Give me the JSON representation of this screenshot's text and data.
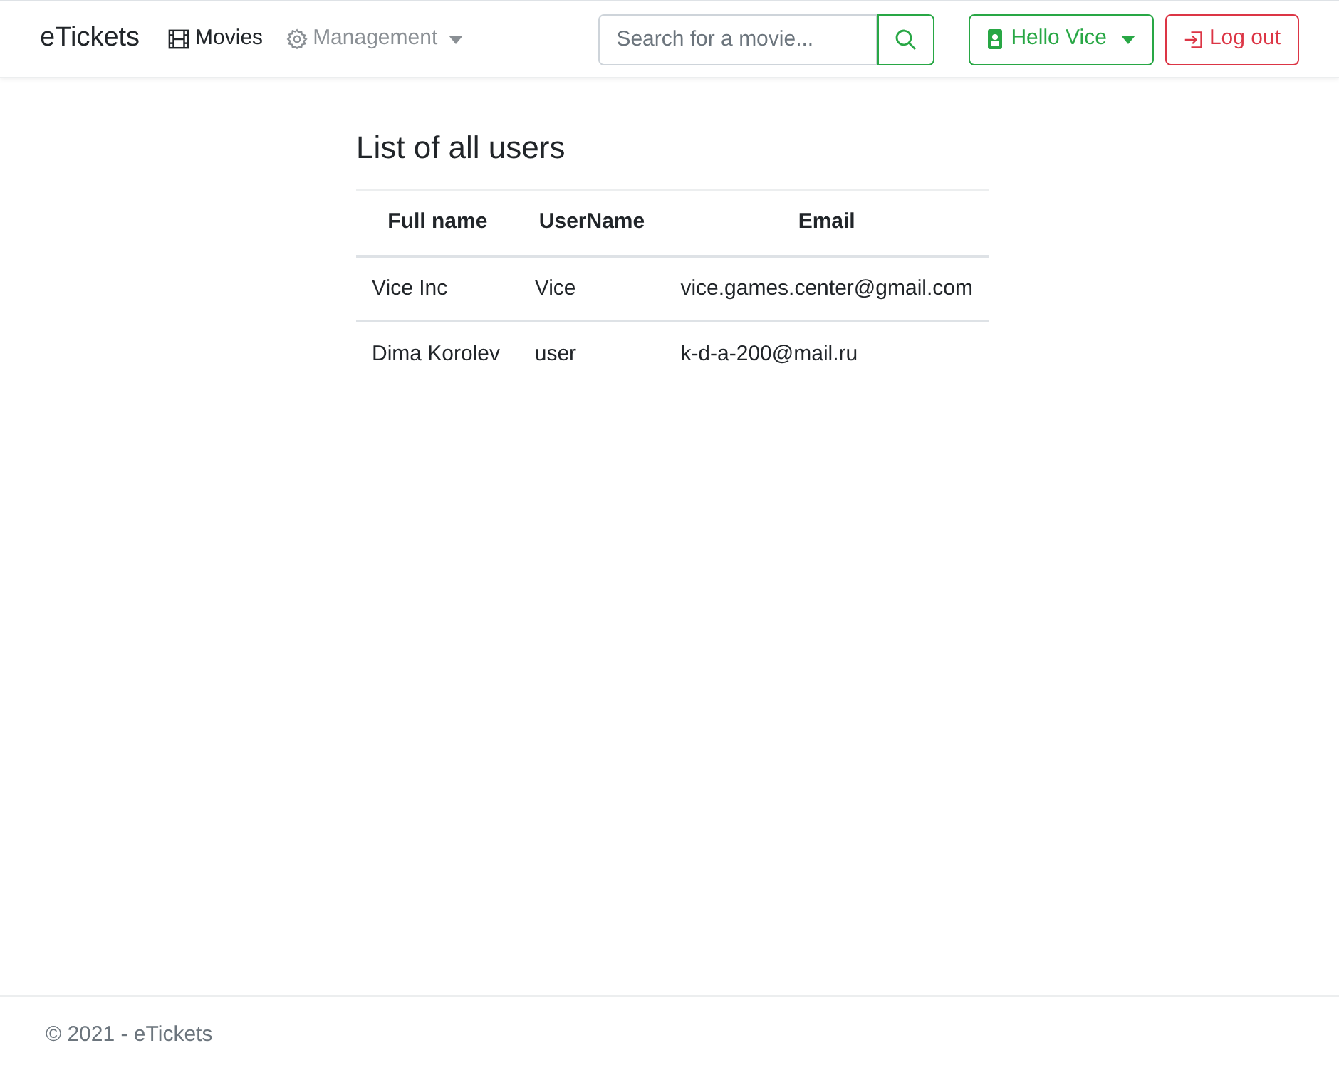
{
  "navbar": {
    "brand": "eTickets",
    "items": [
      {
        "label": "Movies",
        "kind": "link"
      },
      {
        "label": "Management",
        "kind": "dropdown"
      }
    ],
    "search": {
      "placeholder": "Search for a movie..."
    },
    "user_button": "Hello Vice",
    "logout_button": "Log out"
  },
  "page": {
    "title": "List of all users"
  },
  "table": {
    "columns": [
      "Full name",
      "UserName",
      "Email"
    ],
    "rows": [
      [
        "Vice Inc",
        "Vice",
        "vice.games.center@gmail.com"
      ],
      [
        "Dima Korolev",
        "user",
        "k-d-a-200@mail.ru"
      ]
    ]
  },
  "footer": "© 2021 - eTickets"
}
